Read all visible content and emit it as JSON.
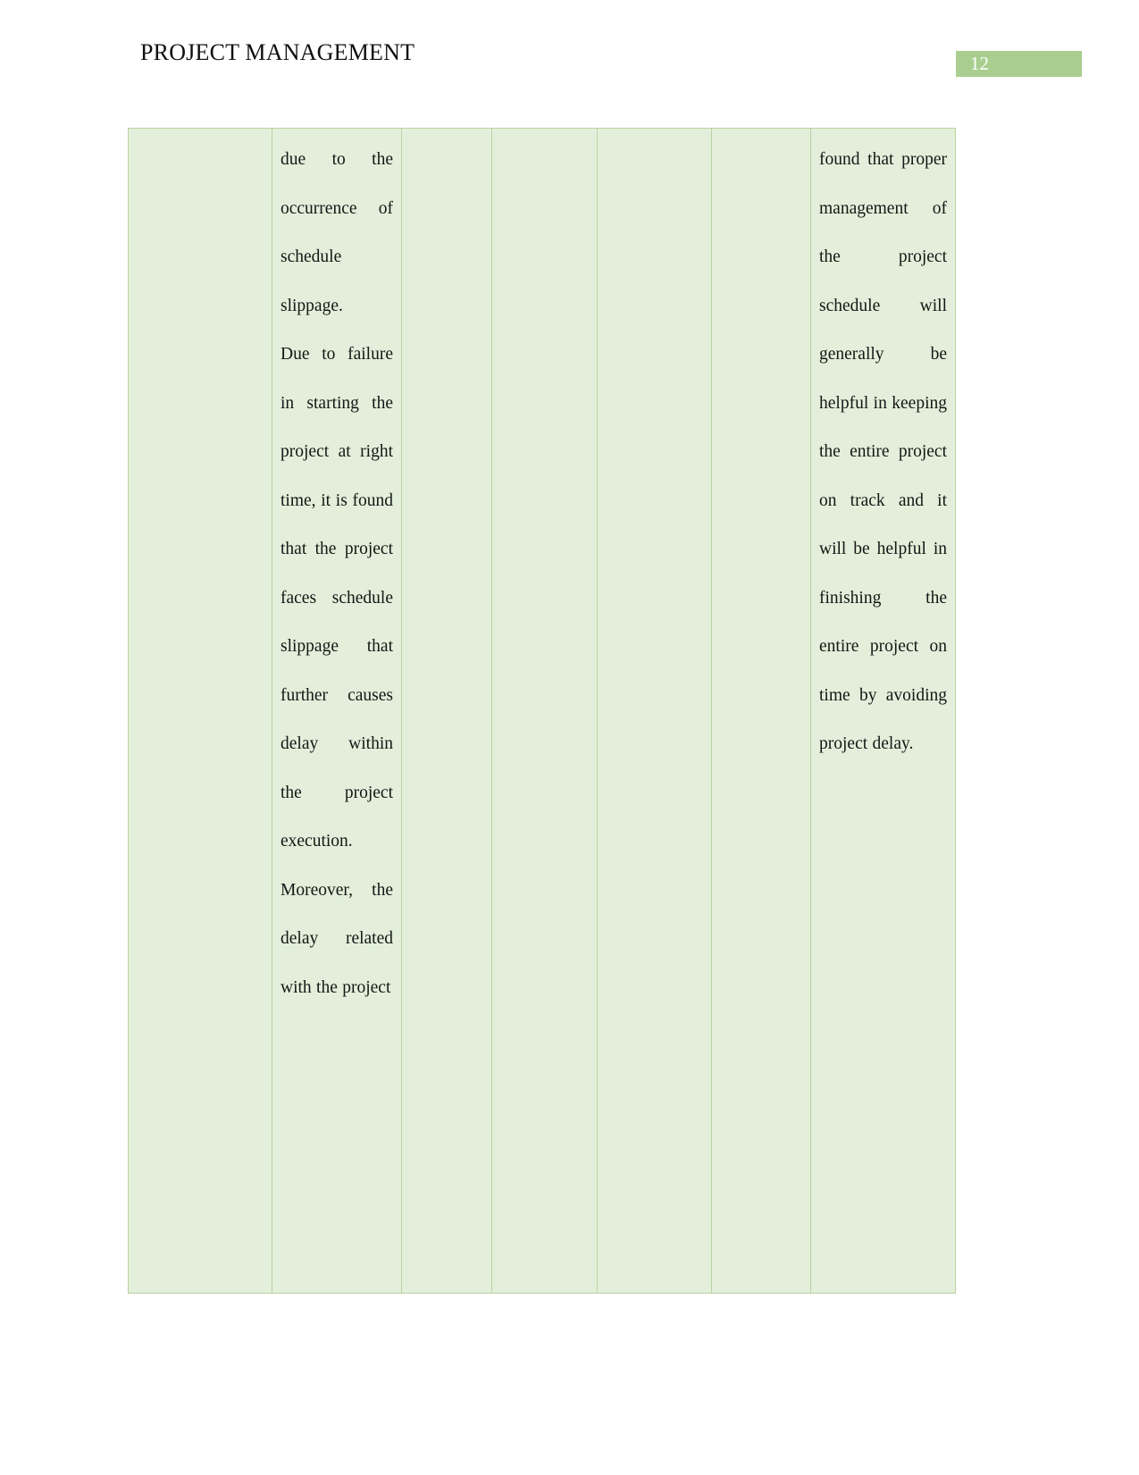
{
  "document": {
    "header_title": "PROJECT MANAGEMENT",
    "page_number": "12",
    "badge_color": "#a9ce8f",
    "cell_fill_color": "#e3efda",
    "cell_border_color": "#b9d3a3"
  },
  "table": {
    "columns": 7,
    "rows": [
      {
        "cells": [
          {
            "name": "cell-col1",
            "text": ""
          },
          {
            "name": "cell-col2",
            "paragraphs": [
              "due to the occurrence of schedule slippage.",
              "Due to failure in starting the project at right time, it is found that the project faces schedule slippage that further causes delay within the project execution.",
              "Moreover, the delay related with the project"
            ]
          },
          {
            "name": "cell-col3",
            "text": ""
          },
          {
            "name": "cell-col4",
            "text": ""
          },
          {
            "name": "cell-col5",
            "text": ""
          },
          {
            "name": "cell-col6",
            "text": ""
          },
          {
            "name": "cell-col7",
            "paragraphs": [
              "found that proper management of the project schedule will generally be helpful in keeping the entire project on track and it will be helpful in finishing the entire project on time by avoiding project delay."
            ]
          }
        ]
      }
    ]
  }
}
